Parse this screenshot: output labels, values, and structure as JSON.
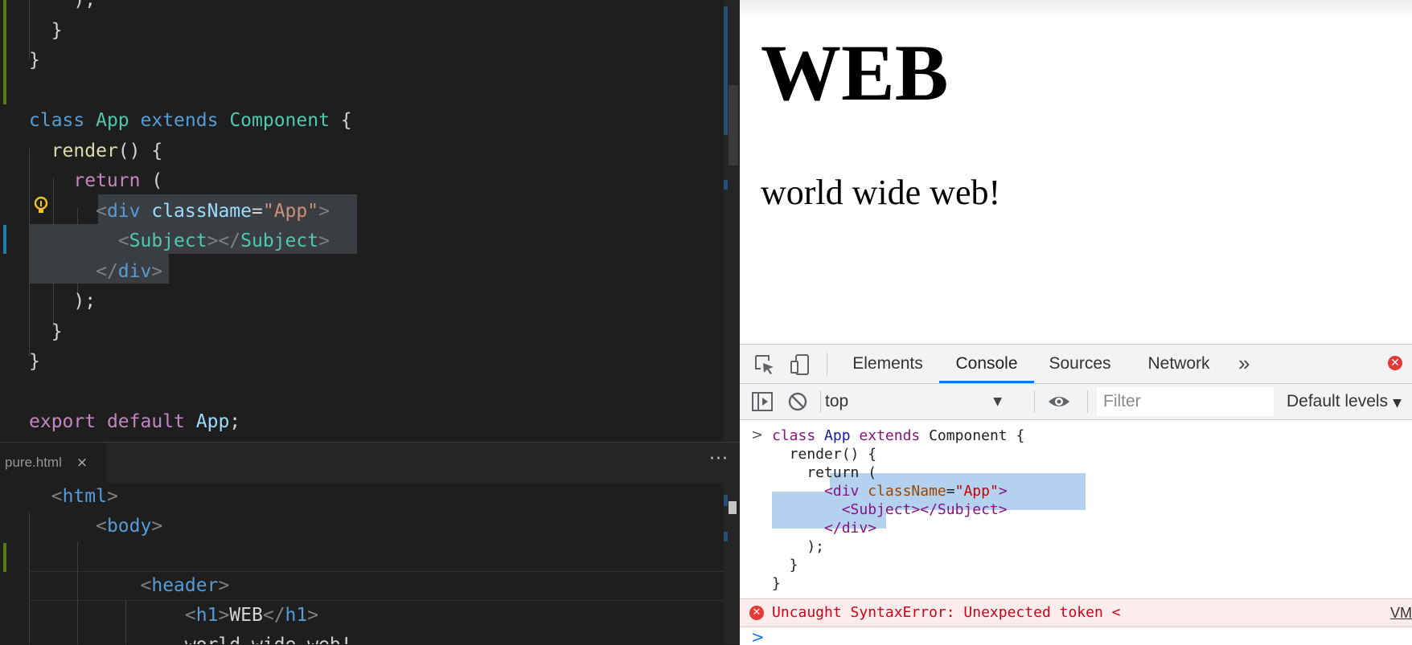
{
  "editor": {
    "top_lines": [
      [
        {
          "c": "txt",
          "t": "    );"
        }
      ],
      [
        {
          "c": "txt",
          "t": "  }"
        }
      ],
      [
        {
          "c": "txt",
          "t": "}"
        }
      ],
      [],
      [
        {
          "c": "kw",
          "t": "class"
        },
        {
          "c": "txt",
          "t": " "
        },
        {
          "c": "cls",
          "t": "App"
        },
        {
          "c": "txt",
          "t": " "
        },
        {
          "c": "kw",
          "t": "extends"
        },
        {
          "c": "txt",
          "t": " "
        },
        {
          "c": "cls",
          "t": "Component"
        },
        {
          "c": "txt",
          "t": " {"
        }
      ],
      [
        {
          "c": "txt",
          "t": "  "
        },
        {
          "c": "fn",
          "t": "render"
        },
        {
          "c": "txt",
          "t": "() {"
        }
      ],
      [
        {
          "c": "txt",
          "t": "    "
        },
        {
          "c": "kw2",
          "t": "return"
        },
        {
          "c": "txt",
          "t": " ("
        }
      ],
      [
        {
          "c": "txt",
          "t": "      "
        },
        {
          "c": "ang",
          "t": "<"
        },
        {
          "c": "tag",
          "t": "div"
        },
        {
          "c": "txt",
          "t": " "
        },
        {
          "c": "attr",
          "t": "className"
        },
        {
          "c": "txt",
          "t": "="
        },
        {
          "c": "str",
          "t": "\"App\""
        },
        {
          "c": "ang",
          "t": ">"
        }
      ],
      [
        {
          "c": "txt",
          "t": "        "
        },
        {
          "c": "ang",
          "t": "<"
        },
        {
          "c": "cls",
          "t": "Subject"
        },
        {
          "c": "ang",
          "t": "></"
        },
        {
          "c": "cls",
          "t": "Subject"
        },
        {
          "c": "ang",
          "t": ">"
        }
      ],
      [
        {
          "c": "txt",
          "t": "      "
        },
        {
          "c": "ang",
          "t": "</"
        },
        {
          "c": "tag",
          "t": "div"
        },
        {
          "c": "ang",
          "t": ">"
        }
      ],
      [
        {
          "c": "txt",
          "t": "    );"
        }
      ],
      [
        {
          "c": "txt",
          "t": "  }"
        }
      ],
      [
        {
          "c": "txt",
          "t": "}"
        }
      ],
      [],
      [
        {
          "c": "kw2",
          "t": "export"
        },
        {
          "c": "txt",
          "t": " "
        },
        {
          "c": "kw2",
          "t": "default"
        },
        {
          "c": "txt",
          "t": " "
        },
        {
          "c": "attr",
          "t": "App"
        },
        {
          "c": "txt",
          "t": ";"
        }
      ]
    ],
    "tab_label": "pure.html",
    "tab_close": "×",
    "tab_more": "···",
    "bottom_lines": [
      [
        {
          "c": "txt",
          "t": "  "
        },
        {
          "c": "ang",
          "t": "<"
        },
        {
          "c": "tag",
          "t": "html"
        },
        {
          "c": "ang",
          "t": ">"
        }
      ],
      [
        {
          "c": "txt",
          "t": "      "
        },
        {
          "c": "ang",
          "t": "<"
        },
        {
          "c": "tag",
          "t": "body"
        },
        {
          "c": "ang",
          "t": ">"
        }
      ],
      [],
      [
        {
          "c": "txt",
          "t": "          "
        },
        {
          "c": "ang",
          "t": "<"
        },
        {
          "c": "tag",
          "t": "header"
        },
        {
          "c": "ang",
          "t": ">"
        }
      ],
      [
        {
          "c": "txt",
          "t": "              "
        },
        {
          "c": "ang",
          "t": "<"
        },
        {
          "c": "tag",
          "t": "h1"
        },
        {
          "c": "ang",
          "t": ">"
        },
        {
          "c": "txt",
          "t": "WEB"
        },
        {
          "c": "ang",
          "t": "</"
        },
        {
          "c": "tag",
          "t": "h1"
        },
        {
          "c": "ang",
          "t": ">"
        }
      ],
      [
        {
          "c": "txt",
          "t": "              world wide web!"
        }
      ]
    ]
  },
  "browser": {
    "heading": "WEB",
    "text": "world wide web!"
  },
  "devtools": {
    "tabs": [
      {
        "label": "Elements",
        "active": false
      },
      {
        "label": "Console",
        "active": true
      },
      {
        "label": "Sources",
        "active": false
      },
      {
        "label": "Network",
        "active": false
      }
    ],
    "more_tabs": "»",
    "error_badge": "✕",
    "context": "top",
    "context_arrow": "▼",
    "filter_placeholder": "Filter",
    "levels": "Default levels",
    "levels_arrow": "▼",
    "console_lines": [
      [
        {
          "c": "ckw",
          "t": "class"
        },
        {
          "c": "t",
          "t": " "
        },
        {
          "c": "ccls",
          "t": "App"
        },
        {
          "c": "t",
          "t": " "
        },
        {
          "c": "ckw",
          "t": "extends"
        },
        {
          "c": "t",
          "t": " Component {"
        }
      ],
      [
        {
          "c": "t",
          "t": "  render() {"
        }
      ],
      [
        {
          "c": "t",
          "t": "    return ("
        }
      ],
      [
        {
          "c": "t",
          "t": "      "
        },
        {
          "c": "ctag",
          "t": "<div"
        },
        {
          "c": "t",
          "t": " "
        },
        {
          "c": "cattr",
          "t": "className"
        },
        {
          "c": "t",
          "t": "="
        },
        {
          "c": "cstr",
          "t": "\"App\""
        },
        {
          "c": "ctag",
          "t": ">"
        }
      ],
      [
        {
          "c": "t",
          "t": "        "
        },
        {
          "c": "ctag",
          "t": "<Subject></Subject>"
        }
      ],
      [
        {
          "c": "t",
          "t": "      "
        },
        {
          "c": "ctag",
          "t": "</div>"
        }
      ],
      [
        {
          "c": "t",
          "t": "    );"
        }
      ],
      [
        {
          "c": "t",
          "t": "  }"
        }
      ],
      [
        {
          "c": "t",
          "t": "}"
        }
      ]
    ],
    "console_prompt": ">",
    "error_icon": "✕",
    "error_message": "Uncaught SyntaxError: Unexpected token <",
    "error_source": "VM",
    "input_prompt": ">"
  }
}
